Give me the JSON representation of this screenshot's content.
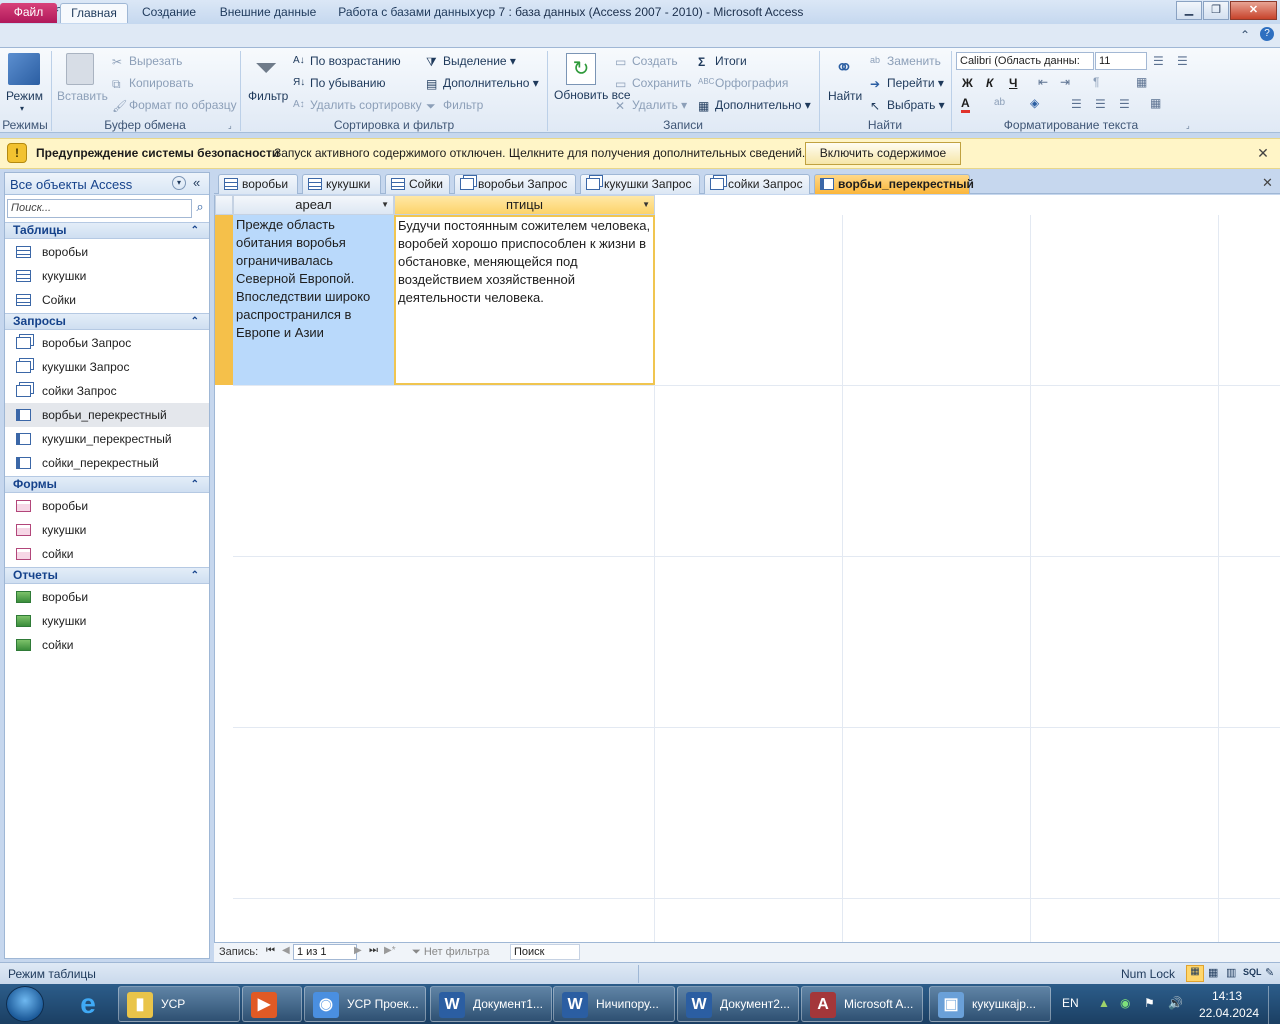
{
  "window": {
    "title": "усp 7 : база данных (Access 2007 - 2010)  -  Microsoft Access",
    "app_icon": "A"
  },
  "ribbon_tabs": [
    {
      "label": "Файл"
    },
    {
      "label": "Главная"
    },
    {
      "label": "Создание"
    },
    {
      "label": "Внешние данные"
    },
    {
      "label": "Работа с базами данных"
    }
  ],
  "ribbon": {
    "views": {
      "mode": "Режим",
      "group": "Режимы"
    },
    "clipboard": {
      "paste": "Вставить",
      "cut": "Вырезать",
      "copy": "Копировать",
      "format_painter": "Формат по образцу",
      "group": "Буфер обмена"
    },
    "sort_filter": {
      "filter": "Фильтр",
      "ascending": "По возрастанию",
      "descending": "По убыванию",
      "remove_sort": "Удалить сортировку",
      "selection": "Выделение",
      "advanced": "Дополнительно",
      "toggle_filter": "Фильтр",
      "group": "Сортировка и фильтр"
    },
    "records": {
      "refresh": "Обновить все",
      "create": "Создать",
      "save": "Сохранить",
      "delete": "Удалить",
      "totals": "Итоги",
      "spelling": "Орфография",
      "more": "Дополнительно",
      "group": "Записи"
    },
    "find": {
      "find": "Найти",
      "replace": "Заменить",
      "goto": "Перейти",
      "select": "Выбрать",
      "group": "Найти"
    },
    "text_format": {
      "font": "Calibri (Область данны:",
      "size": "11",
      "bold": "Ж",
      "italic": "К",
      "underline": "Ч",
      "group": "Форматирование текста"
    }
  },
  "security": {
    "title": "Предупреждение системы безопасности",
    "message": "Запуск активного содержимого отключен. Щелкните для получения дополнительных сведений.",
    "enable": "Включить содержимое"
  },
  "nav": {
    "title": "Все объекты Access",
    "search_placeholder": "Поиск...",
    "sections": [
      {
        "title": "Таблицы",
        "items": [
          "воробьи",
          "кукушки",
          "Сойки"
        ]
      },
      {
        "title": "Запросы",
        "items": [
          "воробьи Запрос",
          "кукушки Запрос",
          "сойки Запрос",
          "ворбьи_перекрестный",
          "кукушки_перекрестный",
          "сойки_перекрестный"
        ]
      },
      {
        "title": "Формы",
        "items": [
          "воробьи",
          "кукушки",
          "сойки"
        ]
      },
      {
        "title": "Отчеты",
        "items": [
          "воробьи",
          "кукушки",
          "сойки"
        ]
      }
    ]
  },
  "doc_tabs": [
    {
      "label": "воробьи"
    },
    {
      "label": "кукушки"
    },
    {
      "label": "Сойки"
    },
    {
      "label": "воробьи Запрос"
    },
    {
      "label": "кукушки Запрос"
    },
    {
      "label": "сойки Запрос"
    },
    {
      "label": "ворбьи_перекрестный"
    }
  ],
  "grid": {
    "columns": [
      "ареал",
      "птицы"
    ],
    "rows": [
      {
        "area": "Прежде область обитания воробья ограничивалась Северной Европой. Впоследствии широко распространился в Европе и Азии",
        "birds": "Будучи постоянным сожителем человека, воробей хорошо приспособлен к жизни в обстановке, меняющейся под воздействием хозяйственной деятельности человека."
      }
    ]
  },
  "record_nav": {
    "label": "Запись:",
    "position": "1 из 1",
    "filter": "Нет фильтра",
    "search": "Поиск"
  },
  "status": {
    "mode": "Режим таблицы",
    "numlock": "Num Lock",
    "sql": "SQL"
  },
  "taskbar": {
    "items": [
      {
        "label": "УСР"
      },
      {
        "label": ""
      },
      {
        "label": "УСР Проек..."
      },
      {
        "label": "Документ1..."
      },
      {
        "label": "Ничипору..."
      },
      {
        "label": "Документ2..."
      },
      {
        "label": "Microsoft A..."
      },
      {
        "label": "кукушкаjp..."
      }
    ],
    "lang": "EN",
    "time": "14:13",
    "date": "22.04.2024"
  }
}
